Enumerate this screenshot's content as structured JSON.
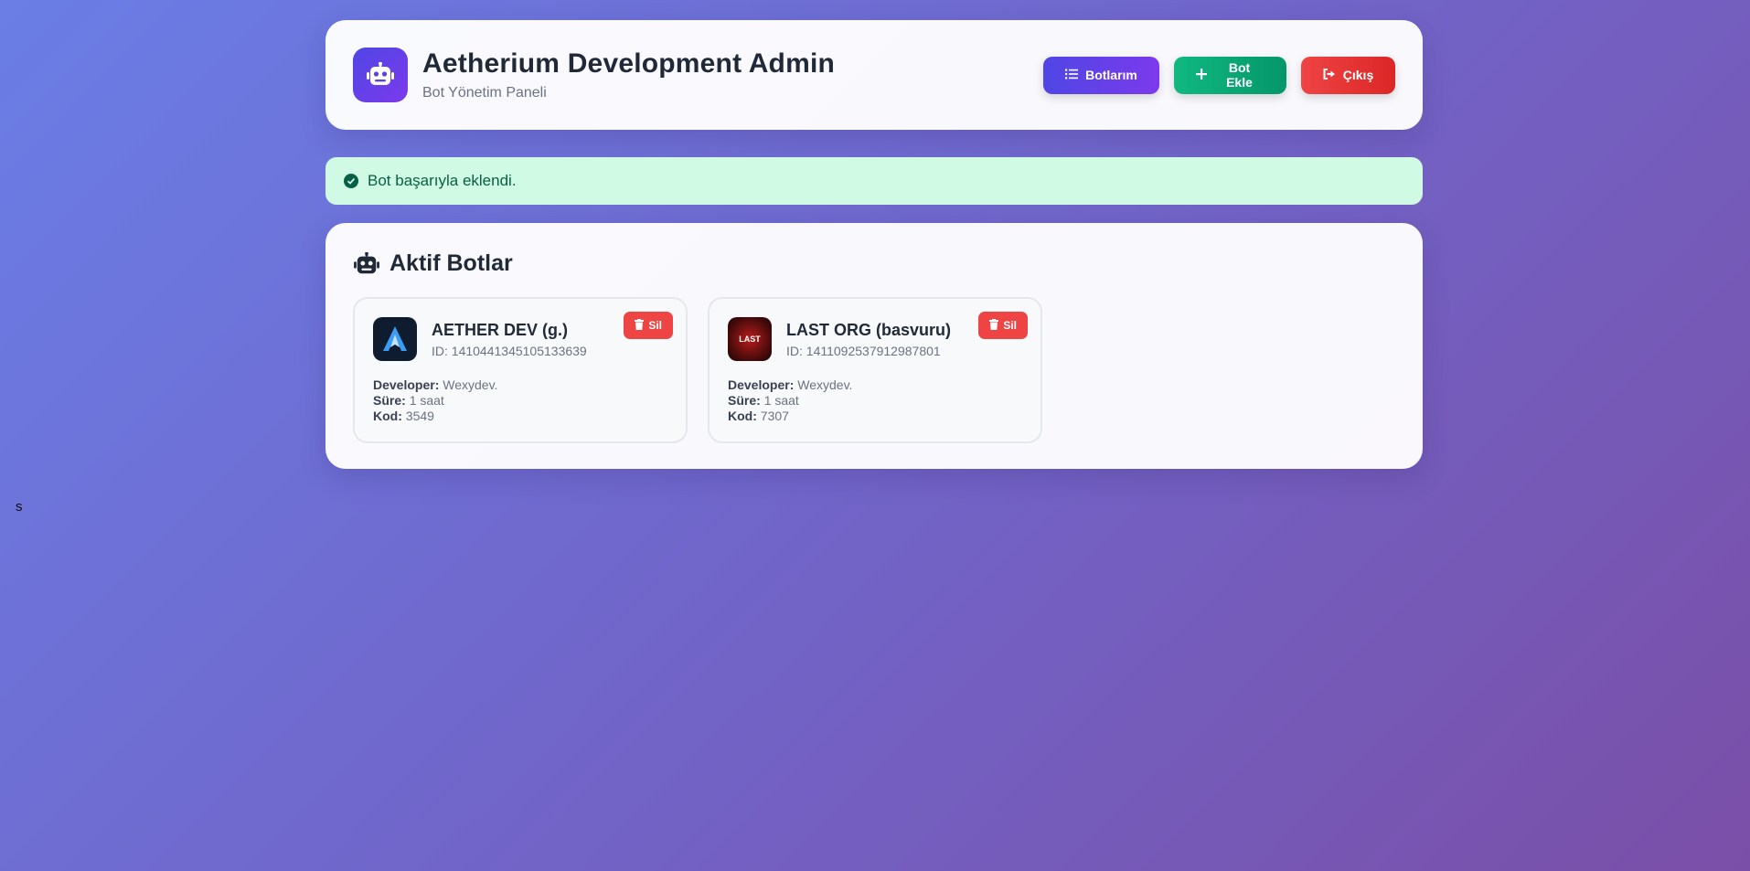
{
  "header": {
    "title": "Aetherium Development Admin",
    "subtitle": "Bot Yönetim Paneli",
    "nav": {
      "bots_label": "Botlarım",
      "add_label": "Bot Ekle",
      "logout_label": "Çıkış"
    }
  },
  "alert": {
    "message": "Bot başarıyla eklendi."
  },
  "panel": {
    "title": "Aktif Botlar",
    "field_labels": {
      "developer": "Developer:",
      "duration": "Süre:",
      "code": "Kod:"
    },
    "delete_label": "Sil",
    "bots": [
      {
        "name": "AETHER DEV (g.)",
        "id": "ID: 1410441345105133639",
        "developer": "Wexydev.",
        "duration": "1 saat",
        "code": "3549",
        "avatar_text": ""
      },
      {
        "name": "LAST ORG (basvuru)",
        "id": "ID: 1411092537912987801",
        "developer": "Wexydev.",
        "duration": "1 saat",
        "code": "7307",
        "avatar_text": "LAST"
      }
    ]
  },
  "stray_text": "s",
  "colors": {
    "primary": "#4f46e5",
    "success": "#10b981",
    "danger": "#ef4444",
    "alert_bg": "#d1fae5"
  }
}
